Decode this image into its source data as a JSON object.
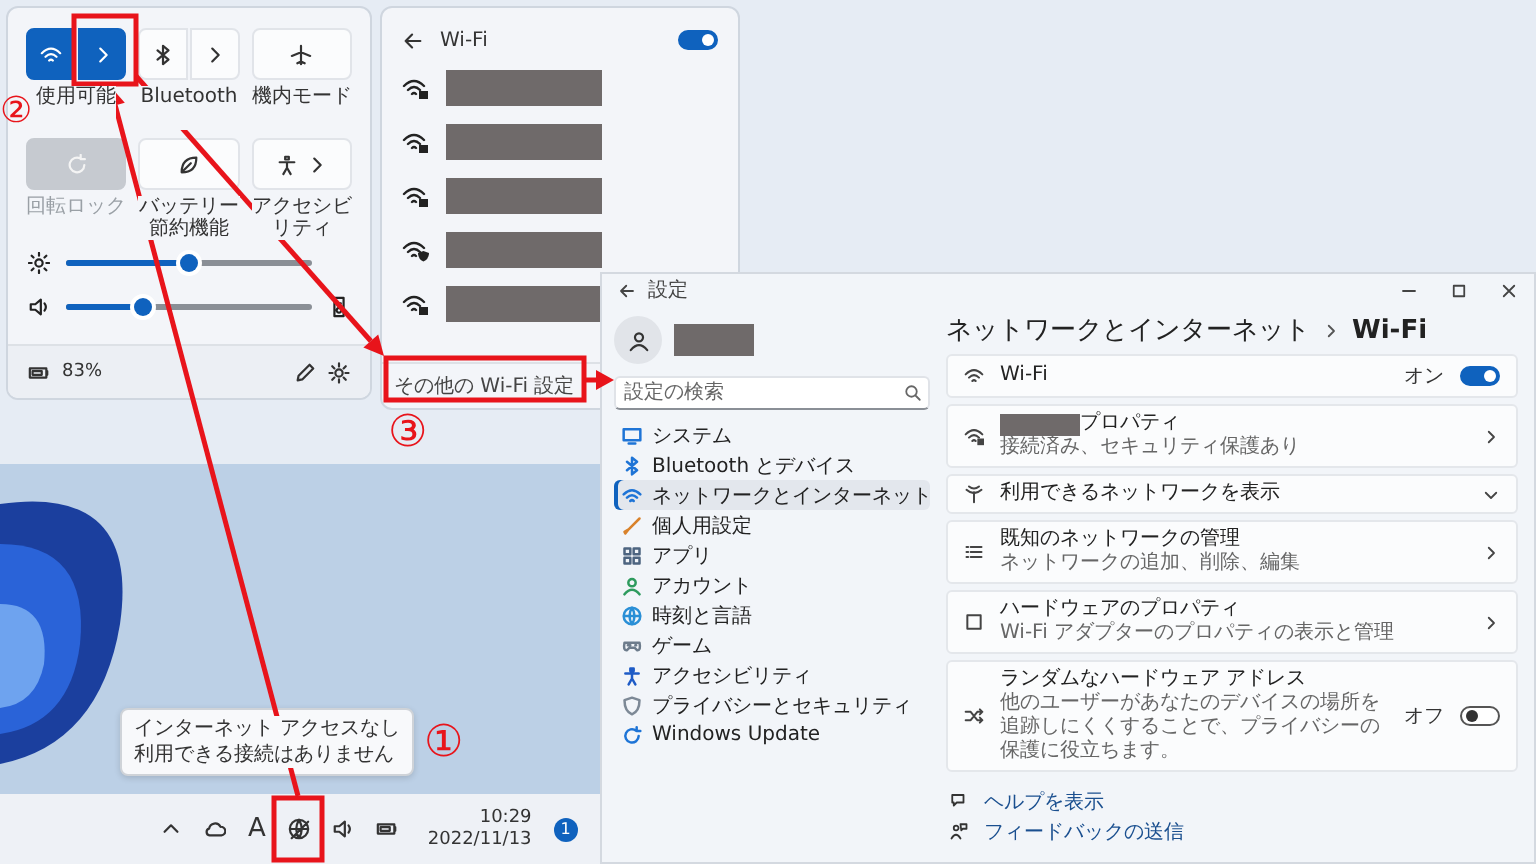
{
  "quick_settings": {
    "tiles": [
      {
        "label": "使用可能",
        "kind": "split",
        "on": true,
        "disabled": false
      },
      {
        "label": "Bluetooth",
        "kind": "split",
        "on": false,
        "disabled": false
      },
      {
        "label": "機内モード",
        "kind": "single",
        "on": false,
        "disabled": false
      },
      {
        "label": "回転ロック",
        "kind": "single",
        "on": false,
        "disabled": true
      },
      {
        "label": "バッテリー節約機能",
        "kind": "single",
        "on": false,
        "disabled": false
      },
      {
        "label": "アクセシビリティ",
        "kind": "expand",
        "on": false,
        "disabled": false
      }
    ],
    "sliders": [
      {
        "kind": "brightness",
        "level": 0.5
      },
      {
        "kind": "volume",
        "level": 0.32
      }
    ],
    "battery": "83%"
  },
  "wifi_panel": {
    "title": "Wi-Fi",
    "on": true,
    "networks": [
      {
        "kind": "secured"
      },
      {
        "kind": "secured"
      },
      {
        "kind": "secured"
      },
      {
        "kind": "shield"
      },
      {
        "kind": "secured"
      }
    ],
    "more_settings": "その他の Wi-Fi 設定"
  },
  "desktop": {
    "tooltip": [
      "インターネット アクセスなし",
      "利用できる接続はありません"
    ],
    "taskbar": {
      "ime_indicator": "A",
      "time": "10:29",
      "date": "2022/11/13",
      "notification_count": "1"
    }
  },
  "settings": {
    "title": "設定",
    "search_placeholder": "設定の検索",
    "nav": [
      {
        "label": "システム",
        "selected": false
      },
      {
        "label": "Bluetooth とデバイス",
        "selected": false
      },
      {
        "label": "ネットワークとインターネット",
        "selected": true
      },
      {
        "label": "個人用設定",
        "selected": false
      },
      {
        "label": "アプリ",
        "selected": false
      },
      {
        "label": "アカウント",
        "selected": false
      },
      {
        "label": "時刻と言語",
        "selected": false
      },
      {
        "label": "ゲーム",
        "selected": false
      },
      {
        "label": "アクセシビリティ",
        "selected": false
      },
      {
        "label": "プライバシーとセキュリティ",
        "selected": false
      },
      {
        "label": "Windows Update",
        "selected": false
      }
    ],
    "breadcrumb": {
      "parent": "ネットワークとインターネット",
      "current": "Wi-Fi"
    },
    "rows": [
      {
        "kind": "toggle",
        "title": "Wi-Fi",
        "state_label": "オン",
        "on": true
      },
      {
        "kind": "link",
        "title": "プロパティ",
        "subtitle": "接続済み、セキュリティ保護あり",
        "name_redacted": true
      },
      {
        "kind": "expand",
        "title": "利用できるネットワークを表示"
      },
      {
        "kind": "link",
        "title": "既知のネットワークの管理",
        "subtitle": "ネットワークの追加、削除、編集"
      },
      {
        "kind": "link",
        "title": "ハードウェアのプロパティ",
        "subtitle": "Wi-Fi アダプターのプロパティの表示と管理"
      },
      {
        "kind": "toggle",
        "title": "ランダムなハードウェア アドレス",
        "subtitle": "他のユーザーがあなたのデバイスの場所を追跡しにくくすることで、プライバシーの保護に役立ちます。",
        "state_label": "オフ",
        "on": false
      }
    ],
    "links": [
      "ヘルプを表示",
      "フィードバックの送信"
    ]
  },
  "callouts": [
    "①",
    "②",
    "③"
  ]
}
